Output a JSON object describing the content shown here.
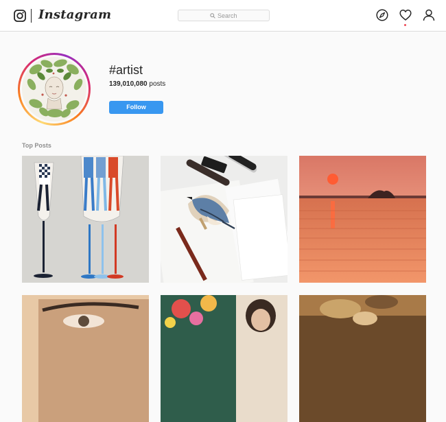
{
  "header": {
    "wordmark": "Instagram",
    "search_placeholder": "Search",
    "icons": [
      "instagram-camera-icon",
      "search-icon",
      "compass-icon",
      "heart-icon",
      "user-icon"
    ],
    "notification_dot_color": "#ed4956"
  },
  "profile": {
    "hashtag": "#artist",
    "post_count_number": "139,010,080",
    "post_count_suffix": " posts",
    "follow_label": "Follow"
  },
  "colors": {
    "accent": "#3897f0",
    "background": "#fafafa",
    "text_primary": "#262626",
    "text_secondary": "#8e8e8e",
    "border": "#dbdbdb"
  },
  "top_posts": {
    "title": "Top Posts"
  }
}
